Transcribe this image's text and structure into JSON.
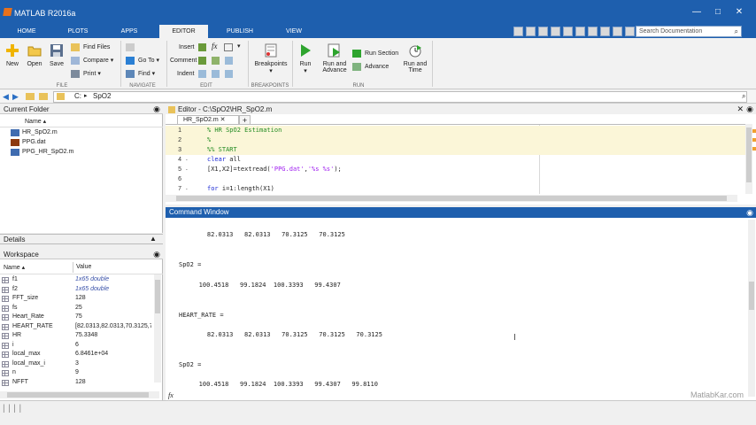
{
  "window": {
    "title": "MATLAB R2016a",
    "minimize": "—",
    "maximize": "□",
    "close": "✕"
  },
  "tabs": [
    {
      "label": "HOME"
    },
    {
      "label": "PLOTS"
    },
    {
      "label": "APPS"
    },
    {
      "label": "EDITOR"
    },
    {
      "label": "PUBLISH"
    },
    {
      "label": "VIEW"
    }
  ],
  "search": {
    "placeholder": "Search Documentation"
  },
  "ribbon": {
    "file": {
      "new": "New",
      "open": "Open",
      "save": "Save",
      "find_files": "Find Files",
      "compare": "Compare",
      "print": "Print",
      "section": "FILE"
    },
    "navigate": {
      "go_to": "Go To",
      "find": "Find",
      "section": "NAVIGATE"
    },
    "edit": {
      "insert": "Insert",
      "comment": "Comment",
      "indent": "Indent",
      "fx": "fx",
      "section": "EDIT"
    },
    "breakpoints": {
      "label": "Breakpoints",
      "section": "BREAKPOINTS"
    },
    "run": {
      "run": "Run",
      "run_and_advance_1": "Run and",
      "run_and_advance_2": "Advance",
      "run_section": "Run Section",
      "advance": "Advance",
      "run_and_time_1": "Run and",
      "run_and_time_2": "Time",
      "section": "RUN"
    }
  },
  "address": {
    "drive": "C:",
    "folder": "SpO2"
  },
  "current_folder": {
    "title": "Current Folder",
    "column": "Name ▴",
    "files": [
      {
        "name": "HR_SpO2.m"
      },
      {
        "name": "PPG.dat"
      },
      {
        "name": "PPG_HR_SpO2.m"
      }
    ]
  },
  "details": {
    "title": "Details"
  },
  "workspace": {
    "title": "Workspace",
    "col_name": "Name ▴",
    "col_value": "Value",
    "vars": [
      {
        "name": "f1",
        "value": "1x65 double",
        "italic": true
      },
      {
        "name": "f2",
        "value": "1x65 double",
        "italic": true
      },
      {
        "name": "FFT_size",
        "value": "128"
      },
      {
        "name": "fs",
        "value": "25"
      },
      {
        "name": "Heart_Rate",
        "value": "75"
      },
      {
        "name": "HEART_RATE",
        "value": "[82.0313,82.0313,70.3125,70"
      },
      {
        "name": "HR",
        "value": "75.3348"
      },
      {
        "name": "i",
        "value": "6"
      },
      {
        "name": "local_max",
        "value": "6.8461e+04"
      },
      {
        "name": "local_max_i",
        "value": "3"
      },
      {
        "name": "n",
        "value": "9"
      },
      {
        "name": "NFFT",
        "value": "128"
      }
    ]
  },
  "editor": {
    "title": "Editor - C:\\SpO2\\HR_SpO2.m",
    "tab": "HR_SpO2.m ✕",
    "add_tab": "+",
    "lines": [
      {
        "n": "1",
        "text": "% HR SpO2 Estimation",
        "kind": "comment"
      },
      {
        "n": "2",
        "text": "%",
        "kind": "comment"
      },
      {
        "n": "3",
        "text": "%% START",
        "kind": "comment"
      },
      {
        "n": "4",
        "text": "clear all",
        "kind": "code",
        "dash": "-"
      },
      {
        "n": "5",
        "text": "[X1,X2]=textread('PPG.dat','%s %s');",
        "kind": "code",
        "dash": "-"
      },
      {
        "n": "6",
        "text": "",
        "kind": "code"
      },
      {
        "n": "7",
        "text": "for i=1:length(X1)",
        "kind": "code",
        "dash": "-"
      }
    ]
  },
  "command_window": {
    "title": "Command Window",
    "outputs": [
      "    82.0313   82.0313   70.3125   70.3125",
      "SpO2 =",
      "   100.4518   99.1824  100.3393   99.4307",
      "HEART_RATE =",
      "    82.0313   82.0313   70.3125   70.3125   70.3125",
      "SpO2 =",
      "   100.4518   99.1824  100.3393   99.4307   99.8110"
    ],
    "prompt": "fx"
  },
  "watermark": "MatlabKar.com",
  "colors": {
    "titlebar": "#1e5fae",
    "comment": "#228b22",
    "string": "#a020f0",
    "keyword": "#1c2ad4"
  }
}
